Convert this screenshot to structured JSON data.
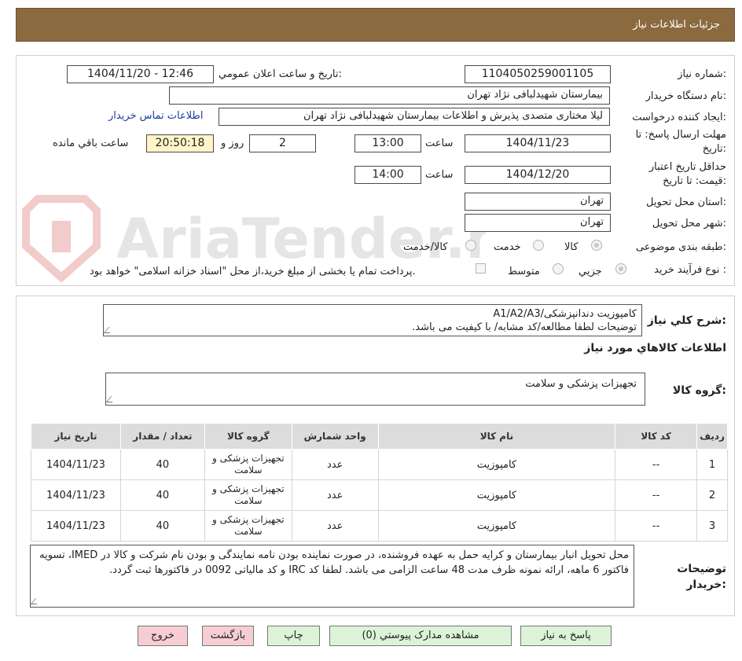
{
  "header": {
    "title": "جزئیات اطلاعات نیاز"
  },
  "form": {
    "need_number_label": "شماره نیاز:",
    "need_number": "1104050259001105",
    "announce_label": "تاریخ و ساعت اعلان عمومي:",
    "announce_value": "1404/11/20 - 12:46",
    "buyer_org_label": "نام دستگاه خریدار:",
    "buyer_org": "بیمارستان شهیدلبافی نژاد تهران",
    "requester_label": "ایجاد کننده درخواست:",
    "requester": "لیلا مختاری متصدی پذیرش و اطلاعات بیمارستان شهیدلبافی نژاد تهران",
    "contact_link": "اطلاعات تماس خریدار",
    "deadline_label_1": "مهلت ارسال پاسخ: تا",
    "deadline_label_2": "تاریخ:",
    "deadline_date": "1404/11/23",
    "time_label": "ساعت",
    "deadline_time": "13:00",
    "days_value": "2",
    "days_label": "روز و",
    "remaining_time": "20:50:18",
    "remaining_label": "ساعت باقي مانده",
    "validity_label_1": "حداقل تاریخ اعتبار",
    "validity_label_2": "قیمت: تا تاریخ:",
    "validity_date": "1404/12/20",
    "validity_time": "14:00",
    "province_label": "استان محل تحویل:",
    "province": "تهران",
    "city_label": "شهر محل تحویل:",
    "city": "تهران",
    "category_label": "طبقه بندی موضوعی:",
    "category_options": [
      "کالا",
      "خدمت",
      "کالا/خدمت"
    ],
    "process_label": "نوع فرآیند خرید :",
    "process_options": [
      "جزیي",
      "متوسط"
    ],
    "payment_note": "پرداخت تمام یا بخشی از مبلغ خرید،از محل \"اسناد خزانه اسلامی\" خواهد بود."
  },
  "summary": {
    "label": "شرح کلي نیاز:",
    "line1": "کامپوزیت دندانپزشکی/A1/A2/A3",
    "line2": "توضیحات لطفا مطالعه/کد مشابه/ با کیفیت می باشد."
  },
  "goods": {
    "section_title": "اطلاعات کالاهاي مورد نیاز",
    "group_label": "گروه کالا:",
    "group_value": "تجهیزات پزشکی و سلامت",
    "columns": [
      "ردیف",
      "کد کالا",
      "نام کالا",
      "واحد شمارش",
      "گروه کالا",
      "تعداد / مقدار",
      "تاریخ نیاز"
    ],
    "rows": [
      {
        "idx": "1",
        "code": "--",
        "name": "کامپوزیت",
        "unit": "عدد",
        "group": "تجهیزات پزشکی و سلامت",
        "qty": "40",
        "date": "1404/11/23"
      },
      {
        "idx": "2",
        "code": "--",
        "name": "کامپوزیت",
        "unit": "عدد",
        "group": "تجهیزات پزشکی و سلامت",
        "qty": "40",
        "date": "1404/11/23"
      },
      {
        "idx": "3",
        "code": "--",
        "name": "کامپوزیت",
        "unit": "عدد",
        "group": "تجهیزات پزشکی و سلامت",
        "qty": "40",
        "date": "1404/11/23"
      }
    ]
  },
  "buyer_notes": {
    "label_1": "توضیحات",
    "label_2": "خریدار:",
    "text": "محل تحویل انبار بیمارستان و کرایه حمل به عهده فروشنده، در صورت نماینده بودن نامه نمایندگی و بودن نام شرکت و کالا در IMED، تسویه فاکتور 6 ماهه، ارائه نمونه ظرف مدت 48 ساعت الزامی می باشد. لطفا کد IRC و کد مالیاتی 0092 در فاکتورها ثبت گردد."
  },
  "buttons": {
    "reply": "پاسخ به نیاز",
    "attachments": "مشاهده مدارک پیوستي (0)",
    "print": "چاپ",
    "back": "بازگشت",
    "exit": "خروج"
  },
  "watermark_text": "AriaTender.neT",
  "colors": {
    "header_bg": "#8b6a3f",
    "remaining_bg": "#fff5c8",
    "btn_green": "#dcf3d8",
    "btn_pink": "#f6cdd3",
    "link": "#1d3d9e"
  }
}
